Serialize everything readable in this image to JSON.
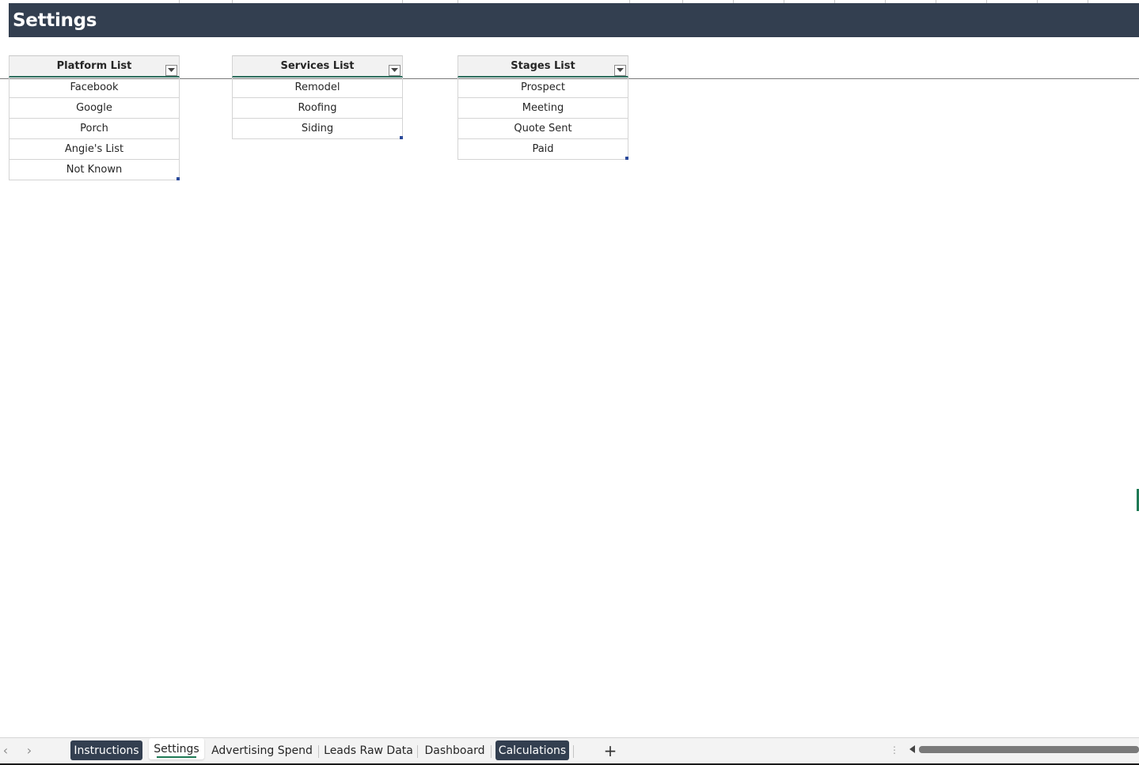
{
  "banner": {
    "title": "Settings"
  },
  "tables": [
    {
      "header": "Platform List",
      "rows": [
        "Facebook",
        "Google",
        "Porch",
        "Angie's List",
        "Not Known"
      ]
    },
    {
      "header": "Services List",
      "rows": [
        "Remodel",
        "Roofing",
        "Siding"
      ]
    },
    {
      "header": "Stages List",
      "rows": [
        "Prospect",
        "Meeting",
        "Quote Sent",
        "Paid"
      ]
    }
  ],
  "sheet_tabs": [
    {
      "label": "Instructions",
      "style": "dark"
    },
    {
      "label": "Settings",
      "style": "active"
    },
    {
      "label": "Advertising Spend",
      "style": "plain"
    },
    {
      "label": "Leads Raw Data",
      "style": "plain"
    },
    {
      "label": "Dashboard",
      "style": "plain"
    },
    {
      "label": "Calculations",
      "style": "dark"
    }
  ],
  "icons": {
    "prev_sheet": "chevron-left-icon",
    "next_sheet": "chevron-right-icon",
    "add_sheet": "plus-icon",
    "filter": "filter-dropdown-icon"
  },
  "colors": {
    "banner_bg": "#333f50",
    "accent_green": "#1e7a55",
    "header_bg": "#f2f2f2"
  }
}
